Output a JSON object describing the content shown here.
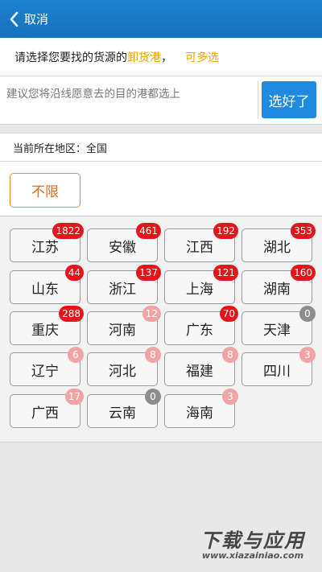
{
  "header": {
    "back_label": "取消"
  },
  "prompt": {
    "part1": "请选择您要找的货源的",
    "highlight": "卸货港",
    "comma": "，",
    "multi": "可多选"
  },
  "search": {
    "placeholder": "建议您将沿线愿意去的目的港都选上",
    "button_label": "选好了"
  },
  "region": {
    "label": "当前所在地区：",
    "value": "全国"
  },
  "unlimited": {
    "label": "不限"
  },
  "provinces": [
    {
      "name": "江苏",
      "count": "1822",
      "badge": "red"
    },
    {
      "name": "安徽",
      "count": "461",
      "badge": "red"
    },
    {
      "name": "江西",
      "count": "192",
      "badge": "red"
    },
    {
      "name": "湖北",
      "count": "353",
      "badge": "red"
    },
    {
      "name": "山东",
      "count": "44",
      "badge": "red"
    },
    {
      "name": "浙江",
      "count": "137",
      "badge": "red"
    },
    {
      "name": "上海",
      "count": "121",
      "badge": "red"
    },
    {
      "name": "湖南",
      "count": "160",
      "badge": "red"
    },
    {
      "name": "重庆",
      "count": "288",
      "badge": "red"
    },
    {
      "name": "河南",
      "count": "12",
      "badge": "pink"
    },
    {
      "name": "广东",
      "count": "70",
      "badge": "red"
    },
    {
      "name": "天津",
      "count": "0",
      "badge": "gray"
    },
    {
      "name": "辽宁",
      "count": "6",
      "badge": "pink"
    },
    {
      "name": "河北",
      "count": "8",
      "badge": "pink"
    },
    {
      "name": "福建",
      "count": "8",
      "badge": "pink"
    },
    {
      "name": "四川",
      "count": "3",
      "badge": "pink"
    },
    {
      "name": "广西",
      "count": "17",
      "badge": "pink"
    },
    {
      "name": "云南",
      "count": "0",
      "badge": "gray"
    },
    {
      "name": "海南",
      "count": "3",
      "badge": "pink"
    }
  ],
  "watermark": {
    "title": "下载与应用",
    "url": "www.xiazainiao.com"
  },
  "colors": {
    "header": "#1a78c8",
    "accent": "#f0a000",
    "badge_red": "#e8141b",
    "badge_pink": "#f2a3a3",
    "badge_gray": "#8d8d8d"
  }
}
